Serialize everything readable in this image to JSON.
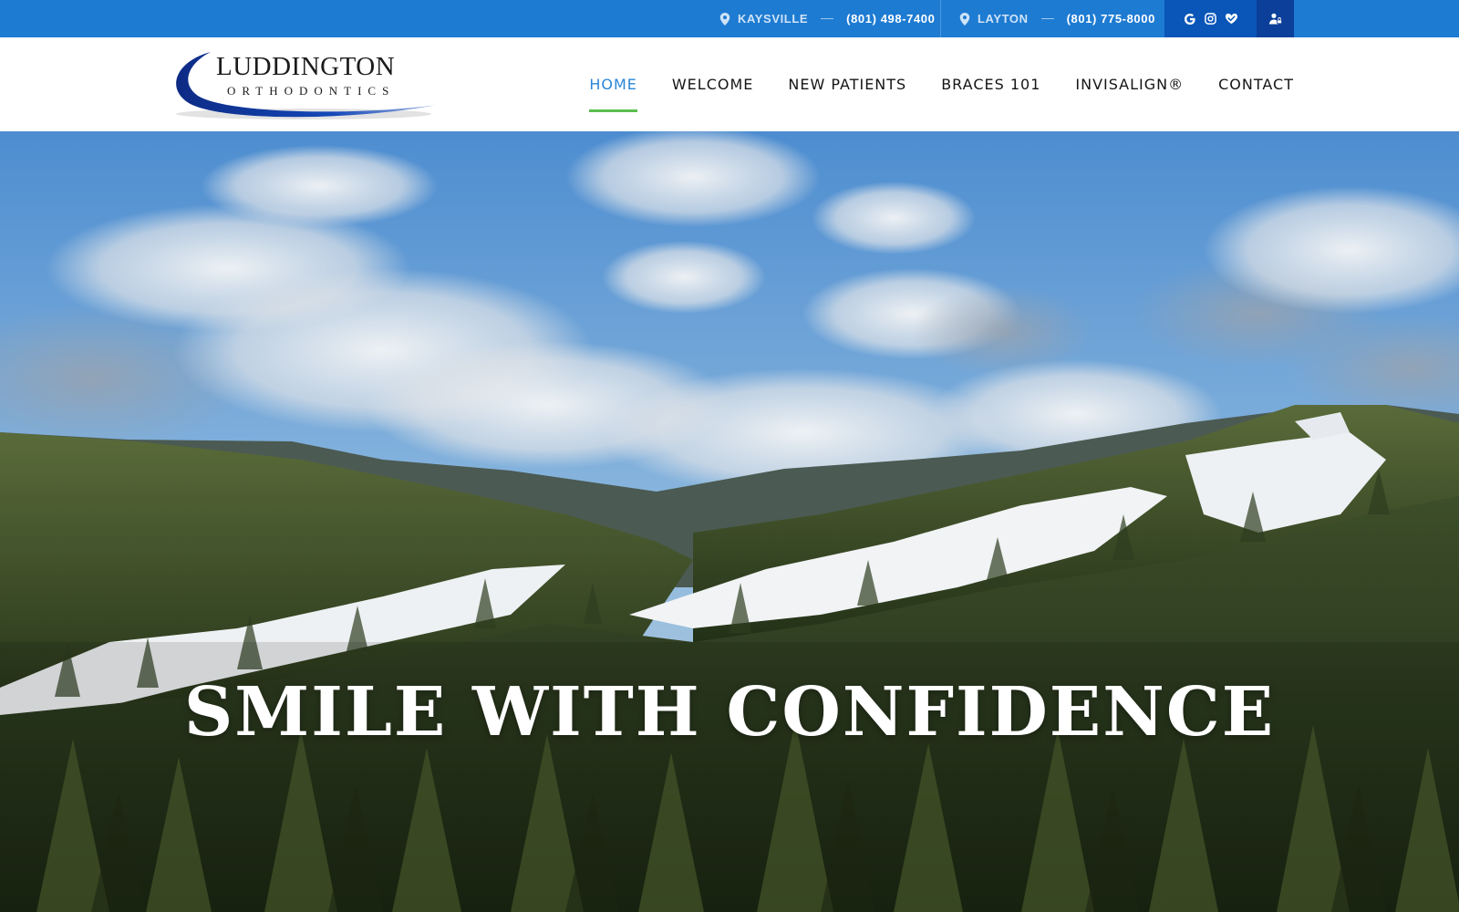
{
  "topbar": {
    "locations": [
      {
        "city": "KAYSVILLE",
        "phone": "(801) 498-7400"
      },
      {
        "city": "LAYTON",
        "phone": "(801) 775-8000"
      }
    ],
    "social_icons": [
      "google-icon",
      "instagram-icon",
      "heart-hands-icon"
    ],
    "portal_icon": "patient-login-icon",
    "colors": {
      "bar": "#1e7bd2",
      "social_bg": "#0a56b8",
      "portal_bg": "#0b3f9a"
    }
  },
  "logo": {
    "title": "LUDDINGTON",
    "subtitle": "ORTHODONTICS"
  },
  "nav": {
    "items": [
      {
        "label": "HOME",
        "active": true
      },
      {
        "label": "WELCOME",
        "active": false
      },
      {
        "label": "NEW PATIENTS",
        "active": false
      },
      {
        "label": "BRACES 101",
        "active": false
      },
      {
        "label": "INVISALIGN®",
        "active": false
      },
      {
        "label": "CONTACT",
        "active": false
      }
    ],
    "colors": {
      "active": "#2a86d6",
      "underline": "#5bbf4e"
    }
  },
  "hero": {
    "title": "SMILE WITH CONFIDENCE"
  }
}
